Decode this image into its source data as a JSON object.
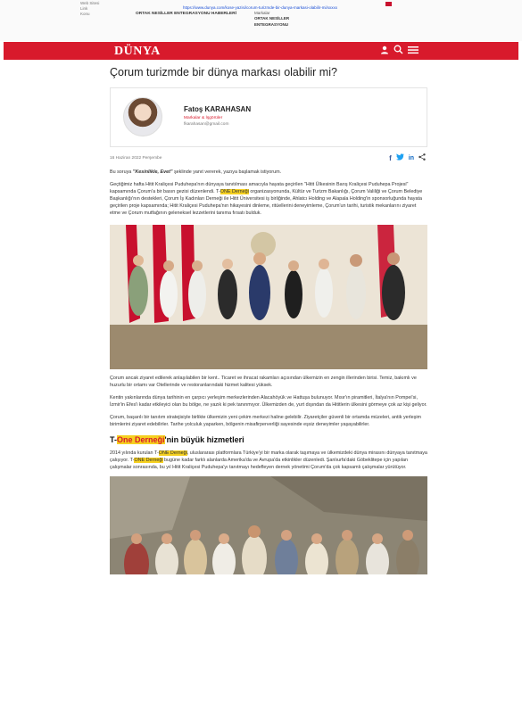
{
  "clipping": {
    "rows": [
      {
        "k": "Web Sitesi",
        "v": "dunya.com"
      },
      {
        "k": "Link",
        "v": ""
      },
      {
        "k": "Konu",
        "v": ""
      }
    ],
    "url": "https://www.dunya.com/kose-yazisi/corum-turizmde-bir-dunya-markasi-olabilir-mi/xxxxx",
    "headline_label": "ORTAK NESİLLER ENTEGRASYONU HABERLERİ",
    "right_label": "Markalar",
    "right_bold": [
      "ORTAK NESİLLER",
      "ENTEGRASYONU"
    ]
  },
  "header": {
    "logo": "DÜNYA",
    "icons": [
      "user-icon",
      "search-icon",
      "menu-icon"
    ],
    "bar_color": "#d81a2c"
  },
  "article": {
    "title": "Çorum turizmde bir dünya markası olabilir mi?",
    "author": {
      "name": "Fatoş KARAHASAN",
      "role": "Markalar & İşgörüler",
      "email": "fkarahasan@gmail.com"
    },
    "date": "16 Haziran 2022 Perşembe",
    "share": [
      "facebook-icon",
      "twitter-icon",
      "linkedin-icon",
      "share-icon"
    ],
    "p1_pre": "Bu soruya ",
    "p1_em": "\"Kesinlikle,  Evet\"",
    "p1_post": " şeklinde yanıt vererek, yazıya başlamak istiyorum.",
    "p2_pre": "Geçtiğimiz hafta Hitit Kraliçesi Puduhepa'nın dünyaya tanıtılması amacıyla hayata geçirilen \"Hitit Ülkesinin Barış Kraliçesi Puduhepa Projesi\" kapsamında Çorum'a bir basın gezisi düzenlendi.  T-",
    "p2_hl": "ONE Derneği",
    "p2_post": " organizasyonunda, Kültür ve Turizm Bakanlığı, Çorum Valiliği ve Çorum Belediye Başkanlığı'nın destekleri, Çorum İş Kadınları Derneği ile Hitit Üniversitesi iş birliğinde, Ahlatcı Holding ve Alapala Holding'in sponsorluğunda hayata geçirilen proje kapsamında; Hitit Kraliçesi Puduhepa'nın hikayesini dinleme,  ritüellerini deneyimleme, Çorum'un tarihi, turistik mekanlarını ziyaret etme ve Çorum mutfağının geleneksel lezzetlerini tanıma fırsatı bulduk.",
    "p3": "Çorum ancak ziyaret edilerek  anlaşılabilen bir kent.. Ticaret ve ihracat rakamları açısından ülkemizin en zengin illerinden birisi. Temiz, bakımlı ve huzurlu bir ortamı var Otellerinde ve restoranlarındaki hizmet kalitesi yüksek.",
    "p4": "Kentin yakınlarında dünya tarihinin en çarpıcı yerleşim merkezlerinden Alacahöyük ve Hattuşa bulunuyor. Mısır'ın piramitleri, İtalya'nın Pompei'si, İzmir'in Efes'i kadar etkileyici olan bu bölge, ne yazık ki pek tanınmıyor.  Ülkemizden de, yurt dışından da Hititlerin ülkesini görmeye çok az kişi geliyor.",
    "p5": "Çorum,  başarılı bir tanıtım stratejisiyle birlikte ülkemizin yeni çekim merkezi haline gelebilir. Ziyaretçiler güvenli bir ortamda müzeleri, antik yerleşim birimlerini ziyaret edebilirler.  Tarihe yolculuk yaparken, bölgenin misafirperverliği sayesinde eşsiz deneyimler yaşayabilirler.",
    "h2_pre": "T-",
    "h2_hl": "One Derneği",
    "h2_post": "'nin büyük hizmetleri",
    "p6_a": "2014 yılında kurulan T-",
    "p6_hl1": "ONE Derneği",
    "p6_b": ", uluslararası platformlara Türkiye'yi bir marka olarak taşımaya ve ülkemizdeki dünya mirasını dünyaya tanıtmaya çalışıyor.  T-",
    "p6_hl2": "ONE Derneği",
    "p6_c": " bugüne kadar farklı alanlarda Amerika'da ve Avrupa'da etkinlikler düzenledi.  Şanlıurfa'daki Göbeklitepe için yapılan çalışmalar sonrasında, bu yıl Hitit Kraliçesi Puduhepa'yı tanıtmayı hedefleyen dernek yönetimi Çorum'da çok kapsamlı çalışmalar yürütüyor."
  },
  "colors": {
    "accent": "#d81a2c",
    "highlight": "#f5d020",
    "link": "#1a4fd6"
  }
}
